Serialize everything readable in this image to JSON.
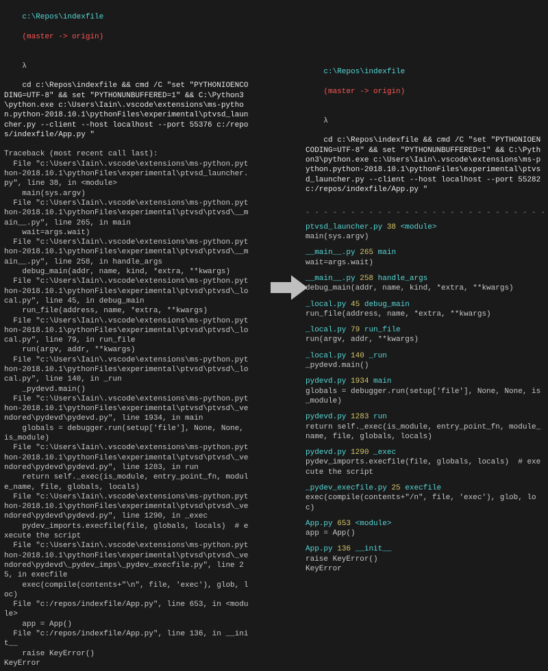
{
  "left": {
    "prompt_path": "c:\\Repos\\indexfile",
    "prompt_branch": "(master -> origin)",
    "lambda": "λ",
    "command": "cd c:\\Repos\\indexfile && cmd /C \"set \"PYTHONIOENCODING=UTF-8\" && set \"PYTHONUNBUFFERED=1\" && C:\\Python3\\python.exe c:\\Users\\Iain\\.vscode\\extensions\\ms-python.python-2018.10.1\\pythonFiles\\experimental\\ptvsd_launcher.py --client --host localhost --port 55376 c:/repos/indexfile/App.py \"",
    "tb_header": "Traceback (most recent call last):",
    "frames": [
      "  File \"c:\\Users\\Iain\\.vscode\\extensions\\ms-python.python-2018.10.1\\pythonFiles\\experimental\\ptvsd_launcher.py\", line 38, in <module>\n    main(sys.argv)",
      "  File \"c:\\Users\\Iain\\.vscode\\extensions\\ms-python.python-2018.10.1\\pythonFiles\\experimental\\ptvsd\\ptvsd\\__main__.py\", line 265, in main\n    wait=args.wait)",
      "  File \"c:\\Users\\Iain\\.vscode\\extensions\\ms-python.python-2018.10.1\\pythonFiles\\experimental\\ptvsd\\ptvsd\\__main__.py\", line 258, in handle_args\n    debug_main(addr, name, kind, *extra, **kwargs)",
      "  File \"c:\\Users\\Iain\\.vscode\\extensions\\ms-python.python-2018.10.1\\pythonFiles\\experimental\\ptvsd\\ptvsd\\_local.py\", line 45, in debug_main\n    run_file(address, name, *extra, **kwargs)",
      "  File \"c:\\Users\\Iain\\.vscode\\extensions\\ms-python.python-2018.10.1\\pythonFiles\\experimental\\ptvsd\\ptvsd\\_local.py\", line 79, in run_file\n    run(argv, addr, **kwargs)",
      "  File \"c:\\Users\\Iain\\.vscode\\extensions\\ms-python.python-2018.10.1\\pythonFiles\\experimental\\ptvsd\\ptvsd\\_local.py\", line 140, in _run\n    _pydevd.main()",
      "  File \"c:\\Users\\Iain\\.vscode\\extensions\\ms-python.python-2018.10.1\\pythonFiles\\experimental\\ptvsd\\ptvsd\\_vendored\\pydevd\\pydevd.py\", line 1934, in main\n    globals = debugger.run(setup['file'], None, None, is_module)",
      "  File \"c:\\Users\\Iain\\.vscode\\extensions\\ms-python.python-2018.10.1\\pythonFiles\\experimental\\ptvsd\\ptvsd\\_vendored\\pydevd\\pydevd.py\", line 1283, in run\n    return self._exec(is_module, entry_point_fn, module_name, file, globals, locals)",
      "  File \"c:\\Users\\Iain\\.vscode\\extensions\\ms-python.python-2018.10.1\\pythonFiles\\experimental\\ptvsd\\ptvsd\\_vendored\\pydevd\\pydevd.py\", line 1290, in _exec\n    pydev_imports.execfile(file, globals, locals)  # execute the script",
      "  File \"c:\\Users\\Iain\\.vscode\\extensions\\ms-python.python-2018.10.1\\pythonFiles\\experimental\\ptvsd\\ptvsd\\_vendored\\pydevd\\_pydev_imps\\_pydev_execfile.py\", line 25, in execfile\n    exec(compile(contents+\"\\n\", file, 'exec'), glob, loc)",
      "  File \"c:/repos/indexfile/App.py\", line 653, in <module>\n    app = App()",
      "  File \"c:/repos/indexfile/App.py\", line 136, in __init__\n    raise KeyError()"
    ],
    "error": "KeyError"
  },
  "right": {
    "prompt_path": "c:\\Repos\\indexfile",
    "prompt_branch": "(master -> origin)",
    "lambda": "λ",
    "command": "cd c:\\Repos\\indexfile && cmd /C \"set \"PYTHONIOENCODING=UTF-8\" && set \"PYTHONUNBUFFERED=1\" && C:\\Python3\\python.exe c:\\Users\\Iain\\.vscode\\extensions\\ms-python.python-2018.10.1\\pythonFiles\\experimental\\ptvsd_launcher.py --client --host localhost --port 55282 c:/repos/indexfile/App.py \"",
    "divider": "- - - - - - - - - - - - - - - - - - - - - - - - - - - - - - - -",
    "frames": [
      {
        "file": "ptvsd_launcher.py",
        "ln": "38",
        "fn": "<module>",
        "code": "main(sys.argv)"
      },
      {
        "file": "__main__.py",
        "ln": "265",
        "fn": "main",
        "code": "wait=args.wait)"
      },
      {
        "file": "__main__.py",
        "ln": "258",
        "fn": "handle_args",
        "code": "debug_main(addr, name, kind, *extra, **kwargs)"
      },
      {
        "file": "_local.py",
        "ln": "45",
        "fn": "debug_main",
        "code": "run_file(address, name, *extra, **kwargs)"
      },
      {
        "file": "_local.py",
        "ln": "79",
        "fn": "run_file",
        "code": "run(argv, addr, **kwargs)"
      },
      {
        "file": "_local.py",
        "ln": "140",
        "fn": "_run",
        "code": "_pydevd.main()"
      },
      {
        "file": "pydevd.py",
        "ln": "1934",
        "fn": "main",
        "code": "globals = debugger.run(setup['file'], None, None, is_module)"
      },
      {
        "file": "pydevd.py",
        "ln": "1283",
        "fn": "run",
        "code": "return self._exec(is_module, entry_point_fn, module_name, file, globals, locals)"
      },
      {
        "file": "pydevd.py",
        "ln": "1290",
        "fn": "_exec",
        "code": "pydev_imports.execfile(file, globals, locals)  # execute the script"
      },
      {
        "file": "_pydev_execfile.py",
        "ln": "25",
        "fn": "execfile",
        "code": "exec(compile(contents+\"/n\", file, 'exec'), glob, loc)"
      },
      {
        "file": "App.py",
        "ln": "653",
        "fn": "<module>",
        "code": "app = App()"
      },
      {
        "file": "App.py",
        "ln": "136",
        "fn": "__init__",
        "code": "raise KeyError()\nKeyError"
      }
    ]
  }
}
